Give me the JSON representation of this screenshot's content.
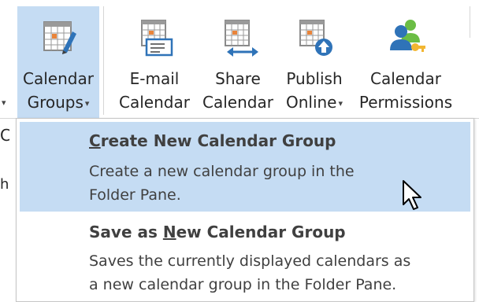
{
  "ribbon": {
    "buttons": [
      {
        "id": "calendar-groups",
        "line1": "Calendar",
        "line2": "Groups",
        "caret": "▾",
        "icon": "calendar-pencil-icon",
        "active": true
      },
      {
        "id": "email-calendar",
        "line1": "E-mail",
        "line2": "Calendar",
        "icon": "calendar-envelope-icon"
      },
      {
        "id": "share-calendar",
        "line1": "Share",
        "line2": "Calendar",
        "icon": "calendar-share-icon"
      },
      {
        "id": "publish-online",
        "line1": "Publish",
        "line2": "Online",
        "caret": "▾",
        "icon": "calendar-upload-icon"
      },
      {
        "id": "calendar-permissions",
        "line1": "Calendar",
        "line2": "Permissions",
        "icon": "users-key-icon"
      }
    ],
    "left_caret": "▾",
    "left_edge_chars": [
      "C",
      "hi"
    ]
  },
  "menu": {
    "items": [
      {
        "title_prefix": "",
        "title_accel": "C",
        "title_rest": "reate New Calendar Group",
        "desc_line1": "Create a new calendar group in the",
        "desc_line2": "Folder Pane.",
        "highlighted": true
      },
      {
        "title_prefix": "Save as ",
        "title_accel": "N",
        "title_rest": "ew Calendar Group",
        "desc_line1": "Saves the currently displayed calendars as",
        "desc_line2": "a new calendar group in the Folder Pane.",
        "highlighted": false
      }
    ]
  },
  "colors": {
    "highlight": "#c5dcf3",
    "text": "#404040",
    "icon_blue": "#2f73b8",
    "icon_orange": "#e9843a"
  }
}
